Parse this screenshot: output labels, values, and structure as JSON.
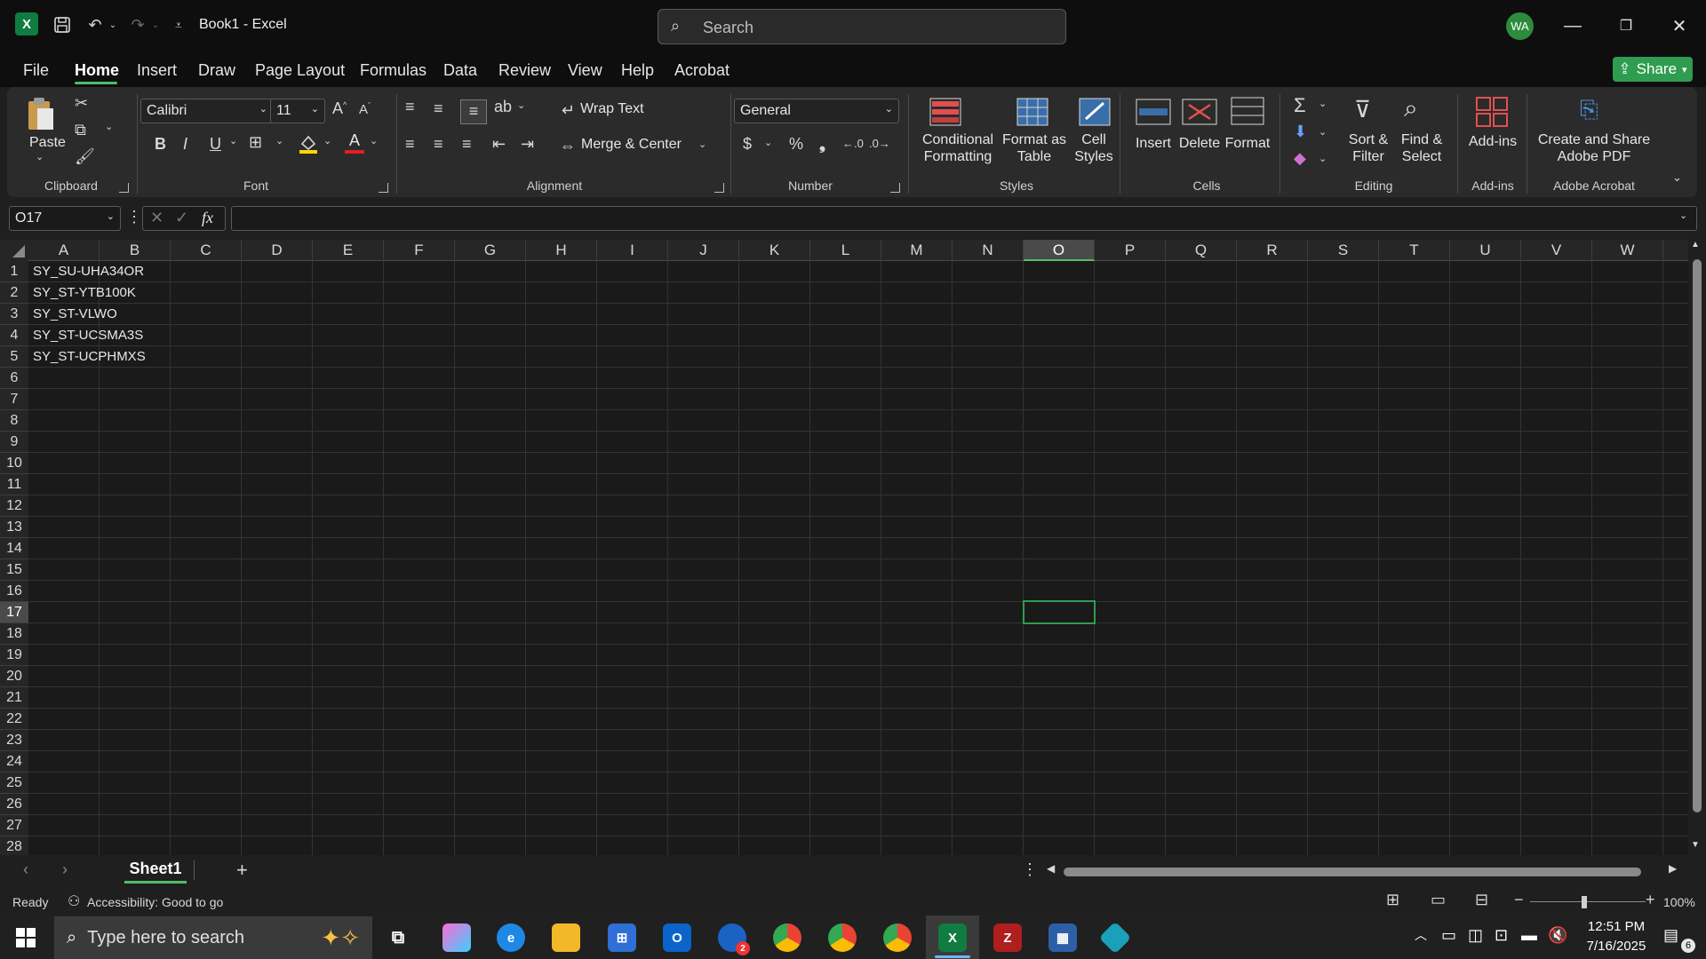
{
  "title_bar": {
    "app_title": "Book1  -  Excel",
    "search_placeholder": "Search",
    "avatar_initials": "WA"
  },
  "menu": {
    "tabs": [
      "File",
      "Home",
      "Insert",
      "Draw",
      "Page Layout",
      "Formulas",
      "Data",
      "Review",
      "View",
      "Help",
      "Acrobat"
    ],
    "active": "Home",
    "share_label": "Share"
  },
  "ribbon": {
    "clipboard": {
      "label": "Clipboard",
      "paste": "Paste"
    },
    "font": {
      "label": "Font",
      "font_name": "Calibri",
      "font_size": "11"
    },
    "alignment": {
      "label": "Alignment",
      "wrap_text": "Wrap Text",
      "merge_center": "Merge & Center"
    },
    "number": {
      "label": "Number",
      "format": "General"
    },
    "styles": {
      "label": "Styles",
      "conditional": "Conditional\nFormatting",
      "format_table": "Format as\nTable",
      "cell_styles": "Cell\nStyles"
    },
    "cells": {
      "label": "Cells",
      "insert": "Insert",
      "delete": "Delete",
      "format": "Format"
    },
    "editing": {
      "label": "Editing",
      "sort_filter": "Sort &\nFilter",
      "find_select": "Find &\nSelect"
    },
    "addins": {
      "label": "Add-ins",
      "addins": "Add-ins"
    },
    "acrobat": {
      "label": "Adobe Acrobat",
      "create_share": "Create and Share\nAdobe PDF"
    }
  },
  "formula_bar": {
    "name_box": "O17",
    "fx": "fx",
    "formula": ""
  },
  "grid": {
    "columns": [
      "A",
      "B",
      "C",
      "D",
      "E",
      "F",
      "G",
      "H",
      "I",
      "J",
      "K",
      "L",
      "M",
      "N",
      "O",
      "P",
      "Q",
      "R",
      "S",
      "T",
      "U",
      "V",
      "W"
    ],
    "selected_column": "O",
    "rows": [
      "1",
      "2",
      "3",
      "4",
      "5",
      "6",
      "7",
      "8",
      "9",
      "10",
      "11",
      "12",
      "13",
      "14",
      "15",
      "16",
      "17",
      "18",
      "19",
      "20",
      "21",
      "22",
      "23",
      "24",
      "25",
      "26",
      "27",
      "28"
    ],
    "selected_row": "17",
    "cells_A": [
      "SY_SU-UHA34OR",
      "SY_ST-YTB100K",
      "SY_ST-VLWO",
      "SY_ST-UCSMA3S",
      "SY_ST-UCPHMXS"
    ]
  },
  "sheets": {
    "tabs": [
      "Sheet1"
    ],
    "active": "Sheet1"
  },
  "status": {
    "ready": "Ready",
    "accessibility": "Accessibility: Good to go",
    "zoom": "100%"
  },
  "taskbar": {
    "search_placeholder": "Type here to search",
    "time": "12:51 PM",
    "date": "7/16/2025",
    "notifications": "6",
    "outlook_badge": "2"
  },
  "colors": {
    "accent": "#107c41",
    "selection": "#2e9d4f",
    "background": "#1a1a1a"
  }
}
